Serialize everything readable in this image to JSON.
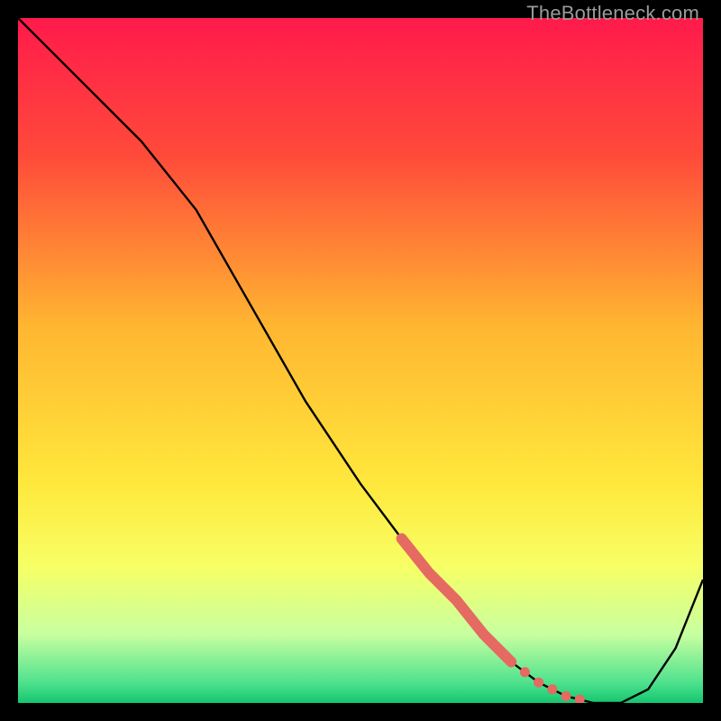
{
  "watermark": "TheBottleneck.com",
  "chart_data": {
    "type": "line",
    "title": "",
    "xlabel": "",
    "ylabel": "",
    "xlim": [
      0,
      100
    ],
    "ylim": [
      0,
      100
    ],
    "background_gradient": {
      "stops": [
        {
          "offset": 0.0,
          "color": "#ff1a4b"
        },
        {
          "offset": 0.2,
          "color": "#ff4a3a"
        },
        {
          "offset": 0.45,
          "color": "#ffb631"
        },
        {
          "offset": 0.68,
          "color": "#ffe83c"
        },
        {
          "offset": 0.8,
          "color": "#f7ff65"
        },
        {
          "offset": 0.9,
          "color": "#c8ffa0"
        },
        {
          "offset": 0.97,
          "color": "#4fe28e"
        },
        {
          "offset": 1.0,
          "color": "#14c66f"
        }
      ]
    },
    "series": [
      {
        "name": "bottleneck-curve",
        "x": [
          0,
          8,
          18,
          26,
          34,
          42,
          50,
          56,
          60,
          64,
          68,
          72,
          76,
          80,
          84,
          88,
          92,
          96,
          100
        ],
        "y": [
          100,
          92,
          82,
          72,
          58,
          44,
          32,
          24,
          19,
          15,
          10,
          6,
          3,
          1,
          0,
          0,
          2,
          8,
          18
        ]
      }
    ],
    "annotations": {
      "highlight_segment": {
        "x_start": 56,
        "x_end": 72
      },
      "highlight_dots_x": [
        74,
        76,
        78,
        80,
        82
      ]
    },
    "colors": {
      "curve": "#000000",
      "highlight": "#e56a61"
    }
  }
}
